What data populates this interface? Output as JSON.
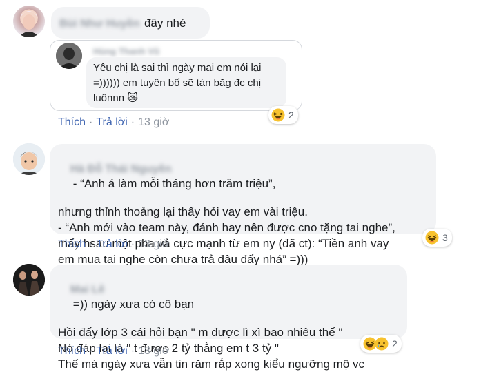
{
  "comments": [
    {
      "author": "Bùi Như Huyền",
      "text": "đây nhé",
      "quoted": {
        "author": "Hùng Thanh Vũ",
        "lines": [
          "Yêu chị là sai thì ngày mai em nói lại",
          "=)))))) em tuyên bố sẽ tán băg đc chị",
          "luônnn 😿"
        ]
      },
      "like": "Thích",
      "reply": "Trả lời",
      "time": "13 giờ",
      "reaction_count": "2"
    },
    {
      "author": "Hà Đỗ Thái Nguyên",
      "lines": [
        "- “Anh á làm mỗi tháng hơn trăm triệu”,",
        "nhưng thỉnh thoảng lại thấy hỏi vay em vài triệu.",
        "- “Anh mới vào team này, đánh hay nên được cno tặng tai nghe”,",
        "mấy hsau một pha vả cực mạnh từ em ny (đã ct): “Tiền anh vay",
        "em mua tai nghe còn chưa trả đâu đấy nhá” =)))"
      ],
      "like": "Thích",
      "reply": "Trả lời",
      "time": "13 giờ",
      "reaction_count": "3"
    },
    {
      "author": "Mai Lê",
      "lines": [
        "=)) ngày xưa có cô bạn",
        "Hồi đấy lớp 3 cái hỏi bạn \" m được lì xì bao nhiêu thế \"",
        "Nó đáp lại là \" t được 2 tỷ thằng em t 3 tỷ \"",
        "Thế mà ngày xưa vẫn tin răm rắp xong kiểu ngưỡng mộ vc"
      ],
      "like": "Thích",
      "reply": "Trả lời",
      "time": "13 giờ",
      "reaction_count": "2"
    }
  ],
  "colors": {
    "link": "#4267b2",
    "bubble": "#f2f3f5",
    "meta": "#8d949e"
  },
  "icons": [
    "laughing-emoji-icon",
    "sad-emoji-icon"
  ]
}
